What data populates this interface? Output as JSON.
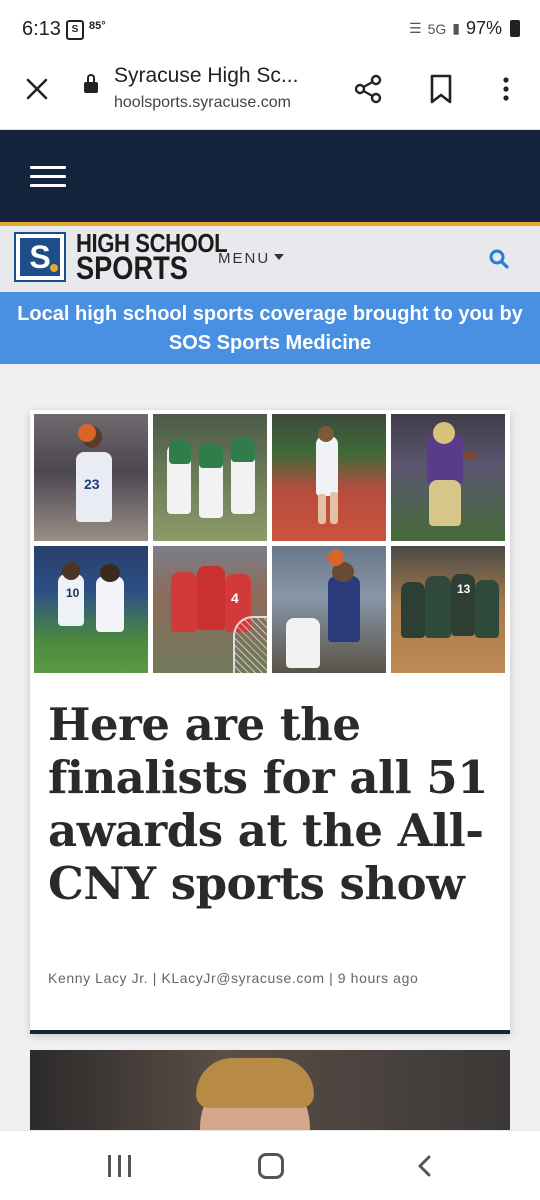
{
  "status_bar": {
    "time": "6:13",
    "temp": "85°",
    "network": "5G",
    "battery": "97%"
  },
  "browser": {
    "title": "Syracuse High Sc...",
    "url": "hoolsports.syracuse.com"
  },
  "site": {
    "logo_line1": "HIGH SCHOOL",
    "logo_line2": "SPORTS",
    "logo_mark": "S",
    "menu_label": "MENU",
    "accent_color": "#e5a72e",
    "header_color": "#14243d"
  },
  "promo": {
    "text": "Local high school sports coverage brought to you by SOS Sports Medicine",
    "color": "#4a90e2"
  },
  "article": {
    "title": "Here are the finalists for all 51 awards at the All-CNY sports show",
    "byline": "Kenny Lacy Jr. | KLacyJr@syracuse.com | 9 hours ago",
    "photos": [
      {
        "sport": "basketball",
        "number": "23"
      },
      {
        "sport": "baseball",
        "number": ""
      },
      {
        "sport": "track",
        "number": ""
      },
      {
        "sport": "football",
        "number": ""
      },
      {
        "sport": "soccer",
        "number": "10"
      },
      {
        "sport": "lacrosse",
        "number": "4"
      },
      {
        "sport": "basketball",
        "number": ""
      },
      {
        "sport": "volleyball",
        "number": "13"
      }
    ]
  }
}
